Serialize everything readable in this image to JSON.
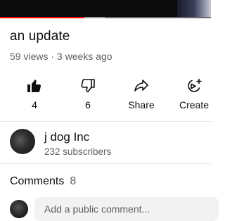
{
  "player": {
    "progress_percent": 40,
    "colors": {
      "progress": "#ff0000",
      "buffer": "#9e9e9e"
    }
  },
  "video": {
    "title": "an update",
    "views": "59 views",
    "separator": "·",
    "age": "3 weeks ago"
  },
  "actions": {
    "like": {
      "label": "4",
      "icon": "thumbs-up-icon"
    },
    "dislike": {
      "label": "6",
      "icon": "thumbs-down-icon"
    },
    "share": {
      "label": "Share",
      "icon": "share-arrow-icon"
    },
    "create": {
      "label": "Create",
      "icon": "create-sparkle-icon"
    }
  },
  "channel": {
    "name": "j dog Inc",
    "subscribers": "232 subscribers"
  },
  "comments": {
    "label": "Comments",
    "count": "8",
    "placeholder": "Add a public comment..."
  }
}
